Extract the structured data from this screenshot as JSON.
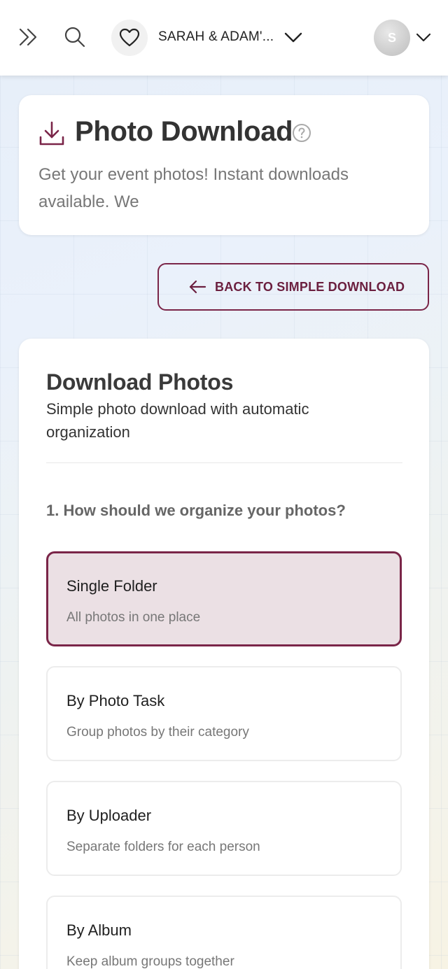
{
  "header": {
    "event_name": "SARAH & ADAM'...",
    "avatar_initial": "S"
  },
  "page": {
    "title": "Photo Download",
    "subtitle": "Get your event photos! Instant downloads available. We"
  },
  "back_button": {
    "label": "BACK TO SIMPLE DOWNLOAD"
  },
  "download_section": {
    "title": "Download Photos",
    "subtitle": "Simple photo download with automatic organization",
    "question": "1. How should we organize your photos?",
    "options": [
      {
        "title": "Single Folder",
        "description": "All photos in one place",
        "selected": true
      },
      {
        "title": "By Photo Task",
        "description": "Group photos by their category",
        "selected": false
      },
      {
        "title": "By Uploader",
        "description": "Separate folders for each person",
        "selected": false
      },
      {
        "title": "By Album",
        "description": "Keep album groups together",
        "selected": false
      }
    ]
  },
  "colors": {
    "accent": "#7a2548",
    "selected_background": "#ebe0e4"
  },
  "icons": [
    "expand-icon",
    "search-icon",
    "heart-icon",
    "chevron-down-icon",
    "download-icon",
    "help-icon",
    "arrow-left-icon"
  ]
}
